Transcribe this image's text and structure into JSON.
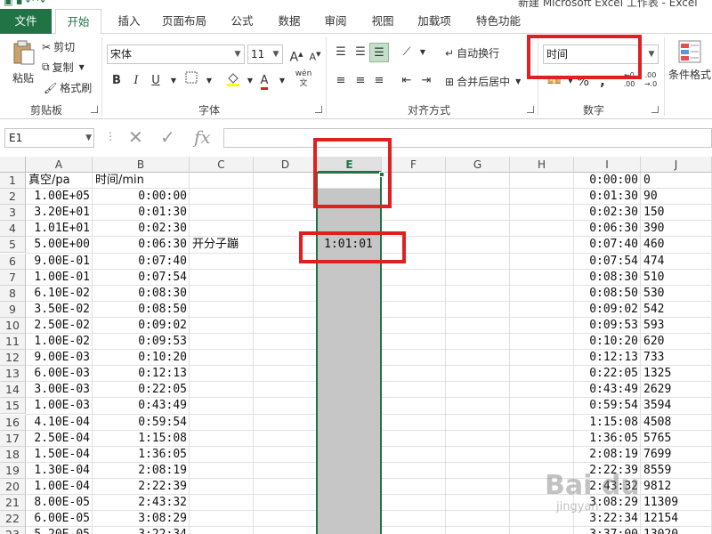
{
  "window": {
    "title": "新建 Microsoft Excel 工作表 - Excel"
  },
  "tabs": [
    "文件",
    "开始",
    "插入",
    "页面布局",
    "公式",
    "数据",
    "审阅",
    "视图",
    "加载项",
    "特色功能"
  ],
  "clipboard": {
    "paste": "粘贴",
    "cut": "剪切",
    "copy": "复制",
    "format_painter": "格式刷",
    "group_label": "剪贴板"
  },
  "font": {
    "family": "宋体",
    "size": "11",
    "group_label": "字体",
    "bold": "B",
    "italic": "I",
    "underline": "U",
    "increase": "A",
    "decrease": "A",
    "phonetic": "wén"
  },
  "alignment": {
    "wrap_text": "自动换行",
    "merge_center": "合并后居中",
    "group_label": "对齐方式"
  },
  "number": {
    "format": "时间",
    "group_label": "数字",
    "percent": "%",
    "comma": ","
  },
  "styles": {
    "conditional_format": "条件格式"
  },
  "formula_bar": {
    "name_box": "E1",
    "fx": "fx",
    "formula": ""
  },
  "columns": [
    "A",
    "B",
    "C",
    "D",
    "E",
    "F",
    "G",
    "H",
    "I",
    "J"
  ],
  "rows": [
    {
      "n": "1",
      "A": "真空/pa",
      "B": "时间/min",
      "C": "",
      "E": "",
      "I": "0:00:00",
      "J": "0"
    },
    {
      "n": "2",
      "A": "1.00E+05",
      "B": "0:00:00",
      "C": "",
      "E": "",
      "I": "0:01:30",
      "J": "90"
    },
    {
      "n": "3",
      "A": "3.20E+01",
      "B": "0:01:30",
      "C": "",
      "E": "",
      "I": "0:02:30",
      "J": "150"
    },
    {
      "n": "4",
      "A": "1.01E+01",
      "B": "0:02:30",
      "C": "",
      "E": "",
      "I": "0:06:30",
      "J": "390"
    },
    {
      "n": "5",
      "A": "5.00E+00",
      "B": "0:06:30",
      "C": "开分子蹦",
      "E": "1:01:01",
      "I": "0:07:40",
      "J": "460"
    },
    {
      "n": "6",
      "A": "9.00E-01",
      "B": "0:07:40",
      "C": "",
      "E": "",
      "I": "0:07:54",
      "J": "474"
    },
    {
      "n": "7",
      "A": "1.00E-01",
      "B": "0:07:54",
      "C": "",
      "E": "",
      "I": "0:08:30",
      "J": "510"
    },
    {
      "n": "8",
      "A": "6.10E-02",
      "B": "0:08:30",
      "C": "",
      "E": "",
      "I": "0:08:50",
      "J": "530"
    },
    {
      "n": "9",
      "A": "3.50E-02",
      "B": "0:08:50",
      "C": "",
      "E": "",
      "I": "0:09:02",
      "J": "542"
    },
    {
      "n": "10",
      "A": "2.50E-02",
      "B": "0:09:02",
      "C": "",
      "E": "",
      "I": "0:09:53",
      "J": "593"
    },
    {
      "n": "11",
      "A": "1.00E-02",
      "B": "0:09:53",
      "C": "",
      "E": "",
      "I": "0:10:20",
      "J": "620"
    },
    {
      "n": "12",
      "A": "9.00E-03",
      "B": "0:10:20",
      "C": "",
      "E": "",
      "I": "0:12:13",
      "J": "733"
    },
    {
      "n": "13",
      "A": "6.00E-03",
      "B": "0:12:13",
      "C": "",
      "E": "",
      "I": "0:22:05",
      "J": "1325"
    },
    {
      "n": "14",
      "A": "3.00E-03",
      "B": "0:22:05",
      "C": "",
      "E": "",
      "I": "0:43:49",
      "J": "2629"
    },
    {
      "n": "15",
      "A": "1.00E-03",
      "B": "0:43:49",
      "C": "",
      "E": "",
      "I": "0:59:54",
      "J": "3594"
    },
    {
      "n": "16",
      "A": "4.10E-04",
      "B": "0:59:54",
      "C": "",
      "E": "",
      "I": "1:15:08",
      "J": "4508"
    },
    {
      "n": "17",
      "A": "2.50E-04",
      "B": "1:15:08",
      "C": "",
      "E": "",
      "I": "1:36:05",
      "J": "5765"
    },
    {
      "n": "18",
      "A": "1.50E-04",
      "B": "1:36:05",
      "C": "",
      "E": "",
      "I": "2:08:19",
      "J": "7699"
    },
    {
      "n": "19",
      "A": "1.30E-04",
      "B": "2:08:19",
      "C": "",
      "E": "",
      "I": "2:22:39",
      "J": "8559"
    },
    {
      "n": "20",
      "A": "1.00E-04",
      "B": "2:22:39",
      "C": "",
      "E": "",
      "I": "2:43:32",
      "J": "9812"
    },
    {
      "n": "21",
      "A": "8.00E-05",
      "B": "2:43:32",
      "C": "",
      "E": "",
      "I": "3:08:29",
      "J": "11309"
    },
    {
      "n": "22",
      "A": "6.00E-05",
      "B": "3:08:29",
      "C": "",
      "E": "",
      "I": "3:22:34",
      "J": "12154"
    },
    {
      "n": "23",
      "A": "5.20E-05",
      "B": "3:22:34",
      "C": "",
      "E": "",
      "I": "3:37:00",
      "J": "13020"
    }
  ],
  "watermark": {
    "main": "Bai du",
    "sub": "jingyan"
  },
  "colors": {
    "excel_green": "#217346",
    "selection_gray": "#c6c6c6",
    "annotation_red": "#e02020"
  }
}
